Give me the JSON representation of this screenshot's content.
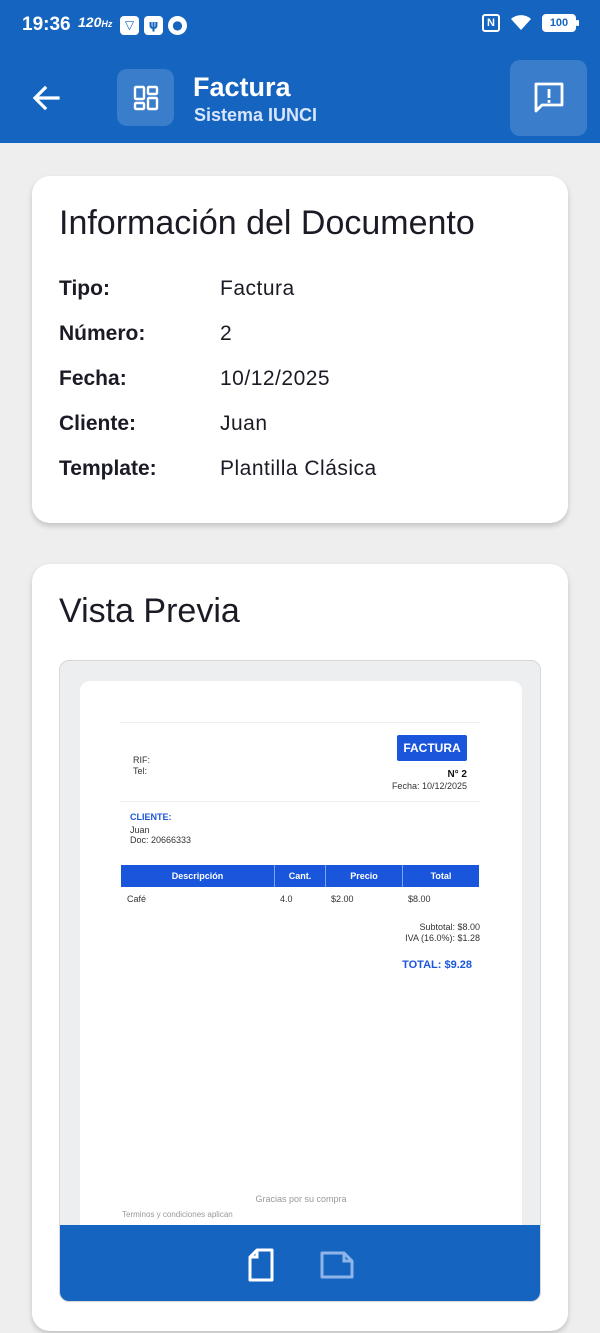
{
  "status_bar": {
    "time": "19:36",
    "refresh": "120",
    "refresh_unit": "Hz",
    "battery": "100",
    "nfc": "N"
  },
  "app_bar": {
    "title": "Factura",
    "subtitle": "Sistema IUNCI"
  },
  "info_card": {
    "title": "Información del Documento",
    "rows": [
      {
        "label": "Tipo:",
        "value": "Factura"
      },
      {
        "label": "Número:",
        "value": "2"
      },
      {
        "label": "Fecha:",
        "value": "10/12/2025"
      },
      {
        "label": "Cliente:",
        "value": "Juan"
      },
      {
        "label": "Template:",
        "value": "Plantilla Clásica"
      }
    ]
  },
  "preview_card": {
    "title": "Vista Previa",
    "invoice": {
      "rif_label": "RIF:",
      "tel_label": "Tel:",
      "badge": "FACTURA",
      "number": "N° 2",
      "date": "Fecha: 10/12/2025",
      "client_label": "CLIENTE:",
      "client_name": "Juan",
      "client_doc": "Doc: 20666333",
      "columns": [
        "Descripción",
        "Cant.",
        "Precio",
        "Total"
      ],
      "rows": [
        [
          "Café",
          "4.0",
          "$2.00",
          "$8.00"
        ]
      ],
      "subtotal": "Subtotal: $8.00",
      "iva": "IVA (16.0%): $1.28",
      "total": "TOTAL: $9.28",
      "thanks": "Gracias por su compra",
      "terms": "Terminos y condiciones aplican"
    }
  },
  "colors": {
    "primary": "#1565c0",
    "invoice_accent": "#1a56db",
    "background": "#eeeeee"
  },
  "icons": {
    "back": "arrow-left-icon",
    "logo": "dashboard-icon",
    "report": "feedback-icon",
    "page_portrait": "document-icon",
    "page_landscape": "document-landscape-icon"
  }
}
